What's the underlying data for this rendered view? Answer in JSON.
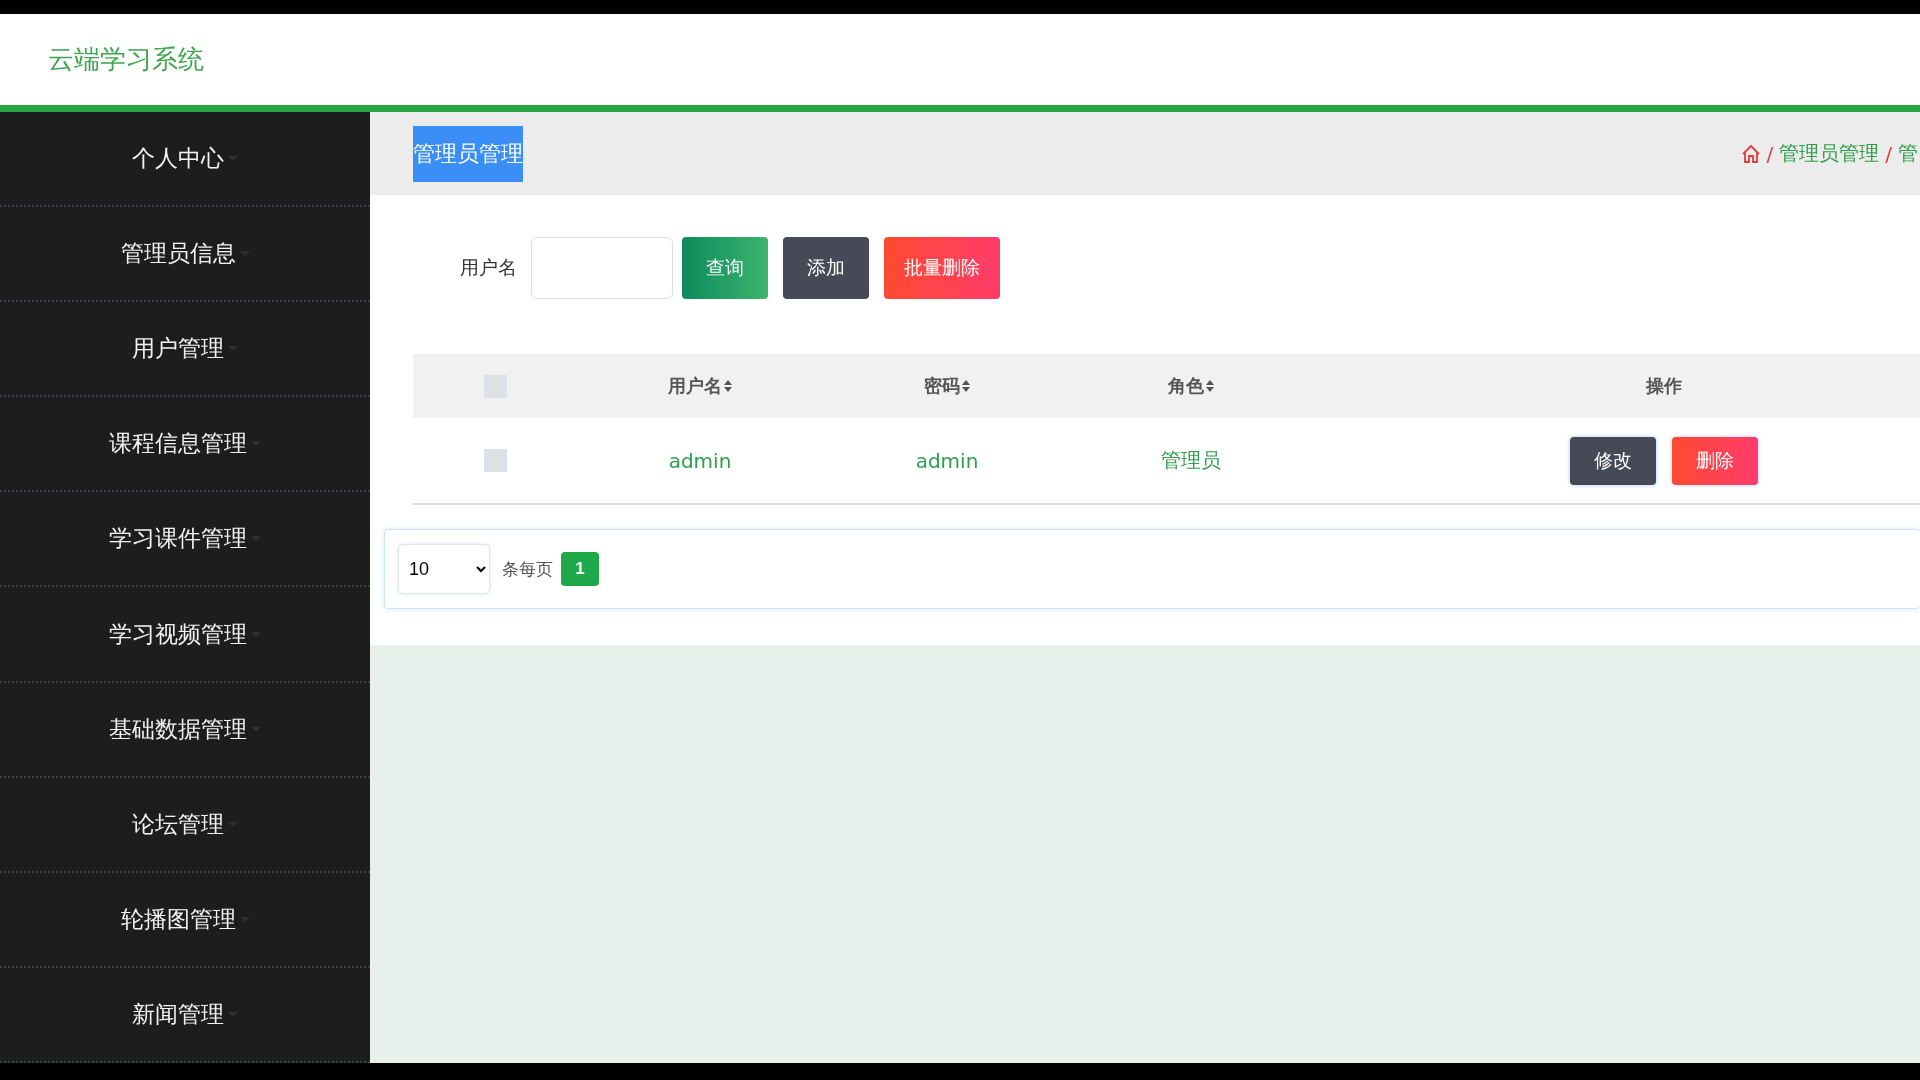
{
  "header": {
    "title": "云端学习系统"
  },
  "sidebar": {
    "items": [
      {
        "label": "个人中心"
      },
      {
        "label": "管理员信息"
      },
      {
        "label": "用户管理"
      },
      {
        "label": "课程信息管理"
      },
      {
        "label": "学习课件管理"
      },
      {
        "label": "学习视频管理"
      },
      {
        "label": "基础数据管理"
      },
      {
        "label": "论坛管理"
      },
      {
        "label": "轮播图管理"
      },
      {
        "label": "新闻管理"
      }
    ]
  },
  "page_tag": "管理员管理",
  "breadcrumb": [
    {
      "separator": "/",
      "label": "管理员管理"
    },
    {
      "separator": "/",
      "label": "管"
    }
  ],
  "search": {
    "label": "用户名",
    "buttons": [
      {
        "label": "查询",
        "kind": "search"
      },
      {
        "label": "添加",
        "kind": "add"
      },
      {
        "label": "批量删除",
        "kind": "delete"
      }
    ]
  },
  "table": {
    "columns": [
      {
        "label": "用户名",
        "sortable": true
      },
      {
        "label": "密码",
        "sortable": true
      },
      {
        "label": "角色",
        "sortable": true
      },
      {
        "label": "操作",
        "sortable": false
      }
    ],
    "header_checked": false,
    "rows": [
      {
        "checked": false,
        "cells": [
          "admin",
          "admin",
          "管理员"
        ],
        "actions": [
          {
            "label": "修改",
            "kind": "edit"
          },
          {
            "label": "删除",
            "kind": "delete"
          }
        ]
      }
    ]
  },
  "pagination": {
    "page_size": "10",
    "label": "条每页",
    "pages": [
      {
        "label": "1",
        "selected": true
      }
    ]
  }
}
